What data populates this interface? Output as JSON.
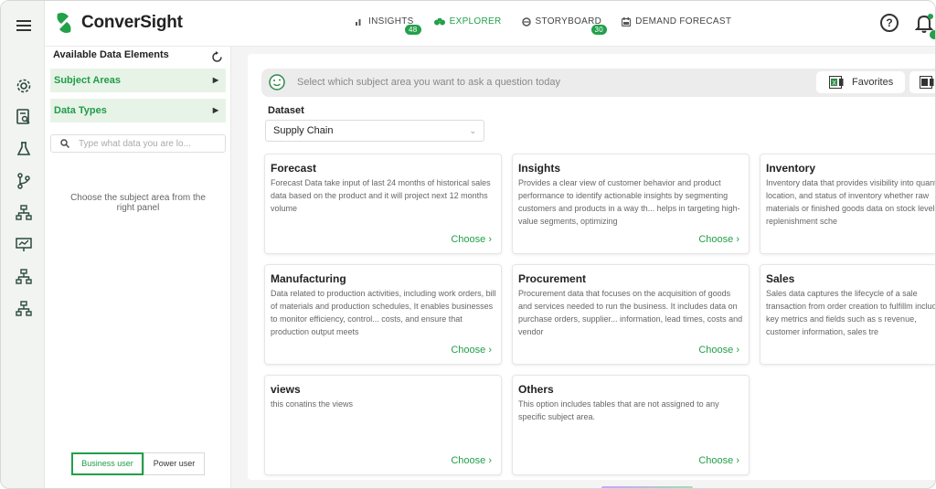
{
  "app": {
    "logo_text": "ConverSight"
  },
  "nav": {
    "items": [
      {
        "label": "INSIGHTS",
        "badge": "48"
      },
      {
        "label": "EXPLORER",
        "badge": ""
      },
      {
        "label": "STORYBOARD",
        "badge": "30"
      },
      {
        "label": "DEMAND FORECAST",
        "badge": ""
      }
    ]
  },
  "header": {
    "help": "?"
  },
  "sidebar": {
    "title": "Available Data Elements",
    "accordions": [
      {
        "label": "Subject Areas"
      },
      {
        "label": "Data Types"
      }
    ],
    "search_placeholder": "Type what data you are lo...",
    "empty_message": "Choose the subject area from the right panel",
    "user_modes": [
      {
        "label": "Business user",
        "active": true
      },
      {
        "label": "Power user",
        "active": false
      }
    ]
  },
  "main": {
    "ask_placeholder": "Select which subject area you want to ask a question today",
    "favorites_label": "Favorites",
    "dataset_label": "Dataset",
    "dataset_value": "Supply Chain",
    "choose_label": "Choose",
    "cards": [
      {
        "title": "Forecast",
        "desc": "Forecast Data take input of last 24 months of historical sales data based on the product and it will project next 12 months volume"
      },
      {
        "title": "Insights",
        "desc": "Provides a clear view of customer behavior and product performance to identify actionable insights by segmenting customers and products in a way th... helps in targeting high-value segments, optimizing"
      },
      {
        "title": "Inventory",
        "desc": "Inventory data that provides visibility into quantity, location, and status of inventory whether raw materials or finished goods data on stock levels, replenishment sche"
      },
      {
        "title": "Manufacturing",
        "desc": "Data related to production activities, including work orders, bill of materials and production schedules, It enables businesses to monitor efficiency, control... costs, and ensure that production output meets"
      },
      {
        "title": "Procurement",
        "desc": "Procurement data that focuses on the acquisition of goods and services needed to run the business. It includes data on purchase orders, supplier... information, lead times, costs and vendor"
      },
      {
        "title": "Sales",
        "desc": "Sales data captures the lifecycle of a sale transaction from order creation to fulfillm includes key metrics and fields such as s revenue, customer information, sales tre"
      },
      {
        "title": "views",
        "desc": "this conatins the views"
      },
      {
        "title": "Others",
        "desc": "This option includes tables that are not assigned to any specific subject area."
      }
    ]
  },
  "colors": {
    "accent": "#22a04a",
    "accent_light": "#e8f3e8"
  }
}
